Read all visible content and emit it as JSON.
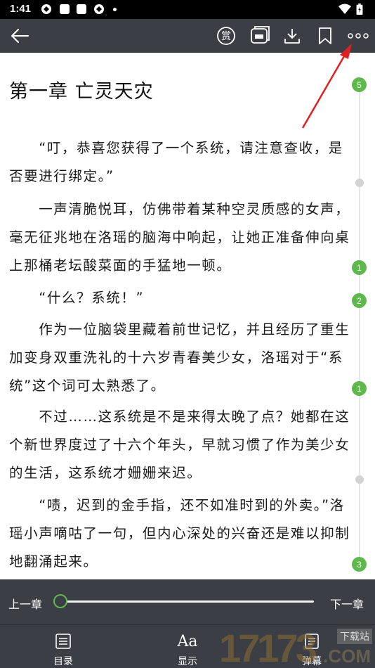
{
  "status_bar": {
    "time": "1:41"
  },
  "toolbar": {
    "back_icon": "back-arrow-icon",
    "reward_label": "赏",
    "icons": [
      "reward-icon",
      "comic-icon",
      "download-icon",
      "bookmark-icon",
      "more-icon"
    ]
  },
  "chapter": {
    "title": "第一章 亡灵天灾",
    "paragraphs": [
      "　　“叮，恭喜您获得了一个系统，请注意查收，是否要进行绑定。”",
      "　　一声清脆悦耳，仿佛带着某种空灵质感的女声，毫无征兆地在洛瑶的脑海中响起，让她正准备伸向桌上那桶老坛酸菜面的手猛地一顿。",
      "　　“什么？系统！”",
      "　　作为一位脑袋里藏着前世记忆，并且经历了重生加变身双重洗礼的十六岁青春美少女，洛瑶对于“系统”这个词可太熟悉了。",
      "　　不过……这系统是不是来得太晚了点？她都在这个新世界度过了十六个年头，早就习惯了作为美少女的生活，这系统才姗姗来迟。",
      "　　“啧，迟到的金手指，还不如准时到的外卖。”洛瑶小声嘀咕了一句，但内心深处的兴奋还是难以抑制地翻涌起来。"
    ],
    "comment_counts": [
      "5",
      "1",
      "2",
      "1",
      "3"
    ]
  },
  "chapter_nav": {
    "prev_label": "上一章",
    "next_label": "下一章",
    "progress": 0.0
  },
  "bottom_bar": {
    "items": [
      {
        "label": "目录",
        "icon": "catalog-icon"
      },
      {
        "label": "显示",
        "icon": "display-icon",
        "glyph": "Aa"
      },
      {
        "label": "弹幕",
        "icon": "danmaku-icon"
      }
    ]
  },
  "watermark": {
    "number": "17173",
    "tag": "下载站",
    "domain": ".COM"
  },
  "colors": {
    "bar": "#3b3e44",
    "accent": "#5fb84d",
    "annotation_arrow": "#e02020"
  }
}
